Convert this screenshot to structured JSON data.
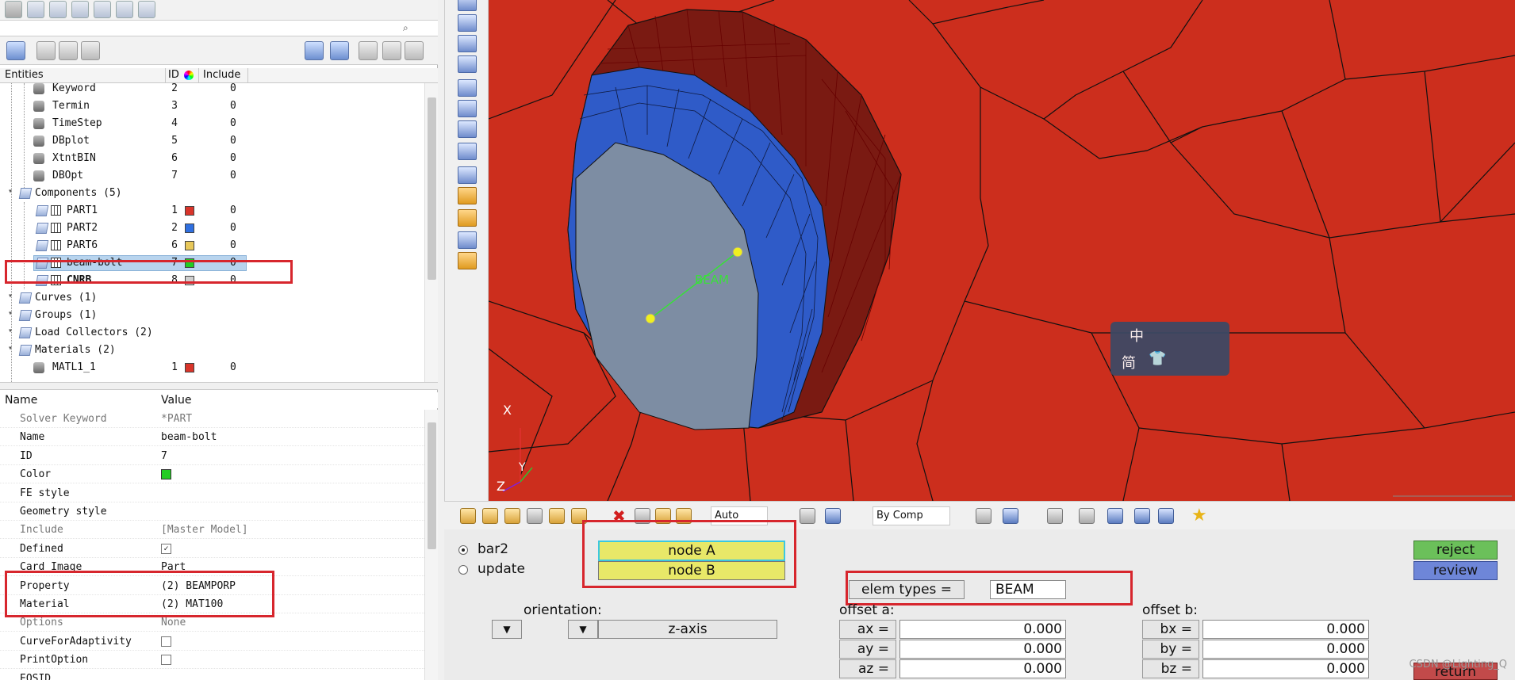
{
  "entities": {
    "headers": {
      "entities": "Entities",
      "id": "ID",
      "include": "Include"
    },
    "rows": [
      {
        "label": "Keyword",
        "id": "2",
        "include": "0",
        "indent": 2
      },
      {
        "label": "Termin",
        "id": "3",
        "include": "0",
        "indent": 2
      },
      {
        "label": "TimeStep",
        "id": "4",
        "include": "0",
        "indent": 2
      },
      {
        "label": "DBplot",
        "id": "5",
        "include": "0",
        "indent": 2
      },
      {
        "label": "XtntBIN",
        "id": "6",
        "include": "0",
        "indent": 2
      },
      {
        "label": "DBOpt",
        "id": "7",
        "include": "0",
        "indent": 2
      },
      {
        "label": "Components (5)",
        "id": "",
        "include": "",
        "indent": 1
      },
      {
        "label": "PART1",
        "id": "1",
        "include": "0",
        "indent": 3,
        "color": "#d9342a"
      },
      {
        "label": "PART2",
        "id": "2",
        "include": "0",
        "indent": 3,
        "color": "#2f6fe0"
      },
      {
        "label": "PART6",
        "id": "6",
        "include": "0",
        "indent": 3,
        "color": "#e8c85a"
      },
      {
        "label": "beam-bolt",
        "id": "7",
        "include": "0",
        "indent": 3,
        "color": "#22cc22",
        "selected": true
      },
      {
        "label": "CNRB",
        "id": "8",
        "include": "0",
        "indent": 3,
        "color": "#cfcfcf",
        "bold": true
      },
      {
        "label": "Curves (1)",
        "id": "",
        "include": "",
        "indent": 1
      },
      {
        "label": "Groups (1)",
        "id": "",
        "include": "",
        "indent": 1
      },
      {
        "label": "Load Collectors (2)",
        "id": "",
        "include": "",
        "indent": 1
      },
      {
        "label": "Materials (2)",
        "id": "",
        "include": "",
        "indent": 1
      },
      {
        "label": "MATL1_1",
        "id": "1",
        "include": "0",
        "indent": 2,
        "color": "#d9342a"
      }
    ]
  },
  "properties": {
    "headers": {
      "name": "Name",
      "value": "Value"
    },
    "rows": [
      {
        "name": "Solver Keyword",
        "value": "*PART",
        "dim": true
      },
      {
        "name": "Name",
        "value": "beam-bolt"
      },
      {
        "name": "ID",
        "value": "7"
      },
      {
        "name": "Color",
        "value": "",
        "swatch": "#22cc22"
      },
      {
        "name": "FE style",
        "value": ""
      },
      {
        "name": "Geometry style",
        "value": ""
      },
      {
        "name": "Include",
        "value": "[Master Model]",
        "dim": true
      },
      {
        "name": "Defined",
        "value": "",
        "checked": true
      },
      {
        "name": "Card Image",
        "value": "Part"
      },
      {
        "name": "Property",
        "value": "(2) BEAMPORP"
      },
      {
        "name": "Material",
        "value": "(2) MAT100"
      },
      {
        "name": "Options",
        "value": "None",
        "dim": true
      },
      {
        "name": "CurveForAdaptivity",
        "value": "",
        "checkbox": true
      },
      {
        "name": "PrintOption",
        "value": "",
        "checkbox": true
      },
      {
        "name": "EOSID",
        "value": ""
      }
    ]
  },
  "viewport": {
    "beam_label": "BEAM",
    "axis_x": "X",
    "axis_y": "Y",
    "axis_z": "Z",
    "widget_char1": "中",
    "widget_char2": "简"
  },
  "toolbar": {
    "auto_label": "Auto",
    "bycomp_label": "By Comp"
  },
  "panel": {
    "bar2": "bar2",
    "update": "update",
    "node_a": "node A",
    "node_b": "node B",
    "elem_types_label": "elem types =",
    "elem_types_value": "BEAM",
    "orientation": "orientation:",
    "zaxis": "z-axis",
    "offset_a": "offset a:",
    "offset_b": "offset b:",
    "ax_label": "ax =",
    "ax": "0.000",
    "ay_label": "ay =",
    "ay": "0.000",
    "az_label": "az =",
    "az": "0.000",
    "bx_label": "bx =",
    "bx": "0.000",
    "by_label": "by =",
    "by": "0.000",
    "bz_label": "bz =",
    "bz": "0.000",
    "reject": "reject",
    "review": "review",
    "return": "return"
  },
  "watermark": "CSDN @Lighting_Q"
}
